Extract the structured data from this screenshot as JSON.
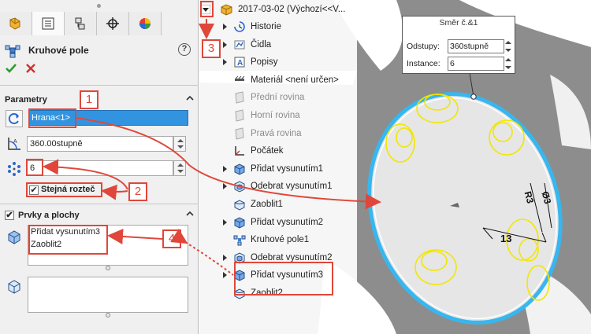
{
  "property_manager": {
    "title": "Kruhové pole",
    "help_label": "?",
    "groups": {
      "parameters": {
        "title": "Parametry"
      },
      "features": {
        "title": "Prvky a plochy"
      }
    },
    "edge_field": {
      "value": "Hrana<1>"
    },
    "angle_field": {
      "value": "360.00stupně"
    },
    "instances_field": {
      "value": "6"
    },
    "equal_spacing": {
      "label": "Stejná rozteč",
      "checked": true
    },
    "features_list": [
      "Přidat vysunutím3",
      "Zaoblit2"
    ]
  },
  "callouts": [
    "1",
    "2",
    "3",
    "4"
  ],
  "tree": {
    "root": "2017-03-02  (Výchozí<<V...",
    "items": [
      {
        "label": "Historie",
        "expand": true,
        "icon": "history-icon"
      },
      {
        "label": "Čidla",
        "expand": true,
        "icon": "sensor-icon"
      },
      {
        "label": "Popisy",
        "expand": true,
        "icon": "annotation-icon"
      },
      {
        "label": "Materiál <není určen>",
        "expand": false,
        "icon": "material-icon"
      },
      {
        "label": "Přední rovina",
        "expand": false,
        "icon": "plane-icon"
      },
      {
        "label": "Horní rovina",
        "expand": false,
        "icon": "plane-icon"
      },
      {
        "label": "Pravá rovina",
        "expand": false,
        "icon": "plane-icon"
      },
      {
        "label": "Počátek",
        "expand": false,
        "icon": "origin-icon"
      },
      {
        "label": "Přidat vysunutím1",
        "expand": true,
        "icon": "extrude-icon"
      },
      {
        "label": "Odebrat vysunutím1",
        "expand": true,
        "icon": "cut-icon"
      },
      {
        "label": "Zaoblit1",
        "expand": false,
        "icon": "fillet-icon"
      },
      {
        "label": "Přidat vysunutím2",
        "expand": true,
        "icon": "extrude-icon"
      },
      {
        "label": "Kruhové pole1",
        "expand": false,
        "icon": "pattern-icon"
      },
      {
        "label": "Odebrat vysunutím2",
        "expand": true,
        "icon": "cut-icon"
      },
      {
        "label": "Přidat vysunutím3",
        "expand": true,
        "icon": "extrude-icon"
      },
      {
        "label": "Zaoblit2",
        "expand": false,
        "icon": "fillet-icon"
      }
    ]
  },
  "tooltip": {
    "title": "Směr č.&1",
    "rows": [
      {
        "label": "Odstupy:",
        "value": "360stupně"
      },
      {
        "label": "Instance:",
        "value": "6"
      }
    ]
  },
  "dimensions": [
    "R3",
    "Ø3",
    "13"
  ],
  "colors": {
    "accent_red": "#e0473a",
    "selection_blue": "#3294e0",
    "pattern_yellow": "#f2e600"
  }
}
